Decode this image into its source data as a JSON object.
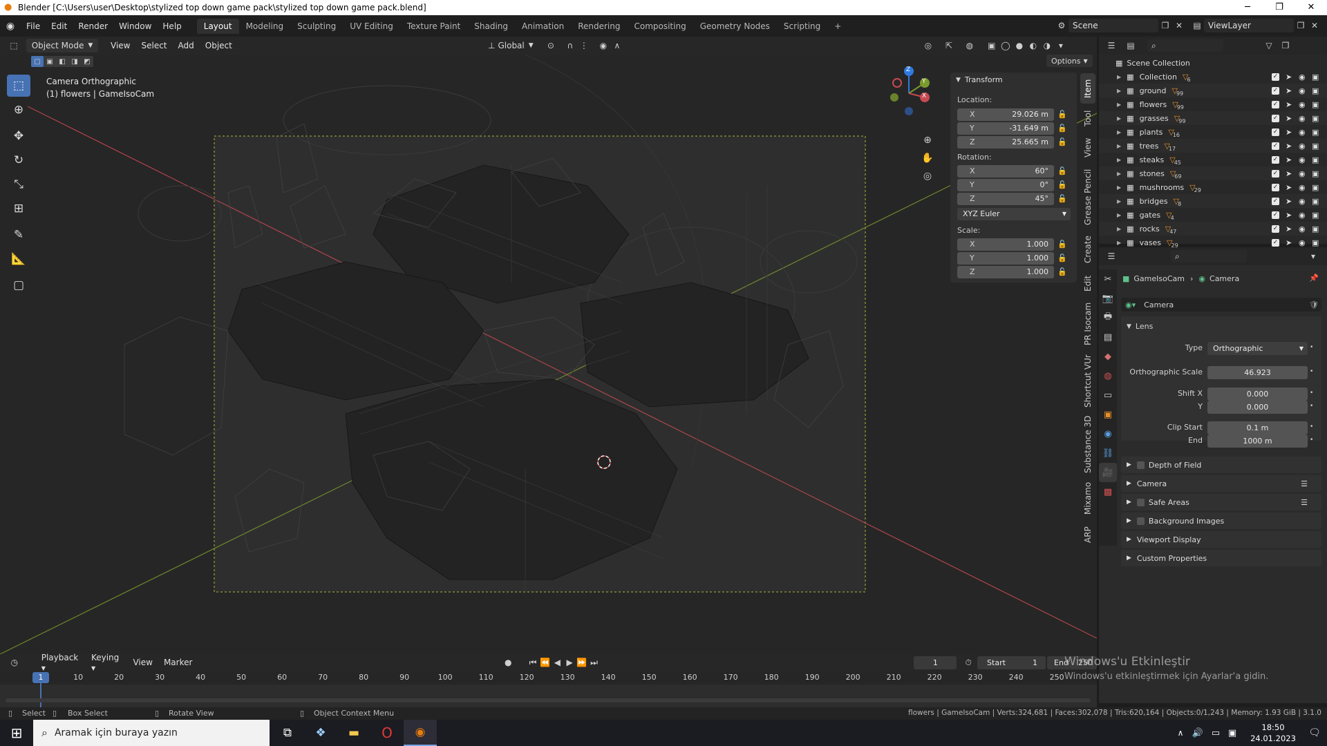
{
  "window": {
    "title": "Blender [C:\\Users\\user\\Desktop\\stylized top down game pack\\stylized top down game pack.blend]",
    "minimize": "─",
    "maximize": "❐",
    "close": "✕"
  },
  "menu": [
    "File",
    "Edit",
    "Render",
    "Window",
    "Help"
  ],
  "workspaces": [
    "Layout",
    "Modeling",
    "Sculpting",
    "UV Editing",
    "Texture Paint",
    "Shading",
    "Animation",
    "Rendering",
    "Compositing",
    "Geometry Nodes",
    "Scripting",
    "+"
  ],
  "scene": {
    "name": "Scene",
    "viewlayer": "ViewLayer"
  },
  "viewport_header": {
    "mode": "Object Mode",
    "menus": [
      "View",
      "Select",
      "Add",
      "Object"
    ],
    "orientation": "Global",
    "options": "Options"
  },
  "viewport": {
    "info_line1": "Camera Orthographic",
    "info_line2": "(1) flowers | GameIsoCam",
    "gizmo": {
      "x": "X",
      "y": "Y",
      "z": "Z"
    }
  },
  "npanel": {
    "title": "Transform",
    "location_label": "Location:",
    "location": [
      {
        "axis": "X",
        "value": "29.026 m"
      },
      {
        "axis": "Y",
        "value": "-31.649 m"
      },
      {
        "axis": "Z",
        "value": "25.665 m"
      }
    ],
    "rotation_label": "Rotation:",
    "rotation": [
      {
        "axis": "X",
        "value": "60°"
      },
      {
        "axis": "Y",
        "value": "0°"
      },
      {
        "axis": "Z",
        "value": "45°"
      }
    ],
    "rotation_mode": "XYZ Euler",
    "scale_label": "Scale:",
    "scale": [
      {
        "axis": "X",
        "value": "1.000"
      },
      {
        "axis": "Y",
        "value": "1.000"
      },
      {
        "axis": "Z",
        "value": "1.000"
      }
    ]
  },
  "side_tabs": [
    "Item",
    "Tool",
    "View",
    "Grease Pencil",
    "Create",
    "Edit",
    "PR Isocam",
    "Shortcut VUr",
    "Substance 3D",
    "Mixamo",
    "ARP"
  ],
  "outliner": {
    "root": "Scene Collection",
    "collections": [
      {
        "name": "Collection",
        "count": "6"
      },
      {
        "name": "ground",
        "count": "99"
      },
      {
        "name": "flowers",
        "count": "99"
      },
      {
        "name": "grasses",
        "count": "99"
      },
      {
        "name": "plants",
        "count": "16"
      },
      {
        "name": "trees",
        "count": "17"
      },
      {
        "name": "steaks",
        "count": "45"
      },
      {
        "name": "stones",
        "count": "69"
      },
      {
        "name": "mushrooms",
        "count": "29"
      },
      {
        "name": "bridges",
        "count": "8"
      },
      {
        "name": "gates",
        "count": "4"
      },
      {
        "name": "rocks",
        "count": "47"
      },
      {
        "name": "vases",
        "count": "29"
      }
    ]
  },
  "properties": {
    "breadcrumb_object": "GameIsoCam",
    "breadcrumb_data": "Camera",
    "datablock": "Camera",
    "lens_title": "Lens",
    "type_label": "Type",
    "type_value": "Orthographic",
    "ortho_label": "Orthographic Scale",
    "ortho_value": "46.923",
    "shiftx_label": "Shift X",
    "shiftx_value": "0.000",
    "shifty_label": "Y",
    "shifty_value": "0.000",
    "clipstart_label": "Clip Start",
    "clipstart_value": "0.1 m",
    "clipend_label": "End",
    "clipend_value": "1000 m",
    "subpanels": [
      "Depth of Field",
      "Camera",
      "Safe Areas",
      "Background Images",
      "Viewport Display",
      "Custom Properties"
    ]
  },
  "timeline": {
    "menus": [
      "Playback",
      "Keying",
      "View",
      "Marker"
    ],
    "current_frame": "1",
    "start_label": "Start",
    "start": "1",
    "end_label": "End",
    "end": "250",
    "ticks": [
      "10",
      "20",
      "30",
      "40",
      "50",
      "60",
      "70",
      "80",
      "90",
      "100",
      "110",
      "120",
      "130",
      "140",
      "150",
      "160",
      "170",
      "180",
      "190",
      "200",
      "210",
      "220",
      "230",
      "240",
      "250"
    ]
  },
  "statusbar": {
    "select": "Select",
    "box_select": "Box Select",
    "rotate_view": "Rotate View",
    "context_menu": "Object Context Menu",
    "stats": "flowers | GameIsoCam | Verts:324,681 | Faces:302,078 | Tris:620,164 | Objects:0/1,243 | Memory: 1.93 GiB | 3.1.0"
  },
  "activation": {
    "line1": "Windows'u Etkinleştir",
    "line2": "Windows'u etkinleştirmek için Ayarlar'a gidin."
  },
  "taskbar": {
    "search_placeholder": "Aramak için buraya yazın",
    "time": "18:50",
    "date": "24.01.2023"
  },
  "colors": {
    "accent": "#4772b3",
    "x_axis": "#c74a52",
    "y_axis": "#7a9a2e",
    "z_axis": "#2f7ae0",
    "camera_frame": "#b4b43c"
  }
}
